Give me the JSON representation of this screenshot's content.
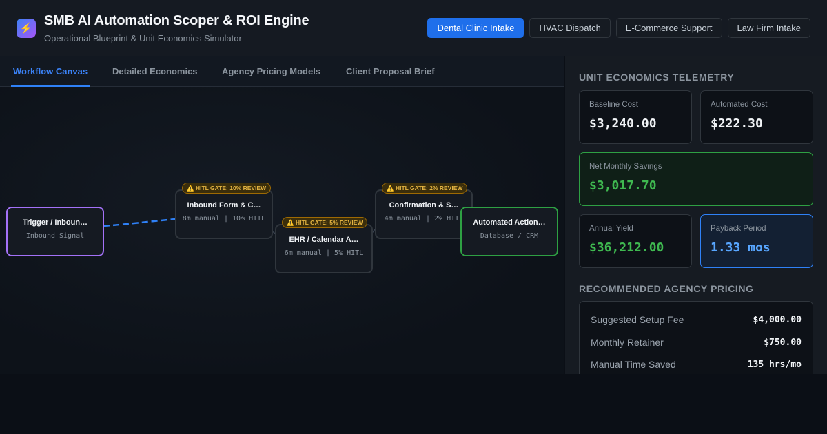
{
  "header": {
    "logo_icon": "⚡",
    "title": "SMB AI Automation Scoper & ROI Engine",
    "subtitle": "Operational Blueprint & Unit Economics Simulator",
    "presets": [
      "Dental Clinic Intake",
      "HVAC Dispatch",
      "E-Commerce Support",
      "Law Firm Intake"
    ],
    "active_preset": "Dental Clinic Intake"
  },
  "tabs": [
    "Workflow Canvas",
    "Detailed Economics",
    "Agency Pricing Models",
    "Client Proposal Brief"
  ],
  "active_tab": "Workflow Canvas",
  "workflow": {
    "nodes": [
      {
        "title": "Trigger / Inboun…",
        "sub": "Inbound Signal",
        "kind": "trigger"
      },
      {
        "title": "Inbound Form & C…",
        "sub": "8m manual | 10% HITL",
        "gate": "⚠️ HITL GATE: 10% REVIEW",
        "kind": "step"
      },
      {
        "title": "EHR / Calendar A…",
        "sub": "6m manual | 5% HITL",
        "gate": "⚠️ HITL GATE: 5% REVIEW",
        "kind": "step"
      },
      {
        "title": "Confirmation & S…",
        "sub": "4m manual | 2% HITL",
        "gate": "⚠️ HITL GATE: 2% REVIEW",
        "kind": "step"
      },
      {
        "title": "Automated Action…",
        "sub": "Database / CRM",
        "kind": "action"
      }
    ]
  },
  "telemetry": {
    "title": "Unit Economics Telemetry",
    "baseline_label": "Baseline Cost",
    "baseline_value": "$3,240.00",
    "automated_label": "Automated Cost",
    "automated_value": "$222.30",
    "savings_label": "Net Monthly Savings",
    "savings_value": "$3,017.70",
    "annual_label": "Annual Yield",
    "annual_value": "$36,212.00",
    "payback_label": "Payback Period",
    "payback_value": "1.33 mos"
  },
  "pricing": {
    "title": "Recommended Agency Pricing",
    "rows": [
      {
        "label": "Suggested Setup Fee",
        "value": "$4,000.00"
      },
      {
        "label": "Monthly Retainer",
        "value": "$750.00"
      },
      {
        "label": "Manual Time Saved",
        "value": "135 hrs/mo"
      }
    ]
  },
  "colors": {
    "accent": "#1f6feb",
    "trigger": "#a371f7",
    "action": "#2ea043",
    "gate": "#e3b341",
    "edge": "#2f81f7"
  }
}
